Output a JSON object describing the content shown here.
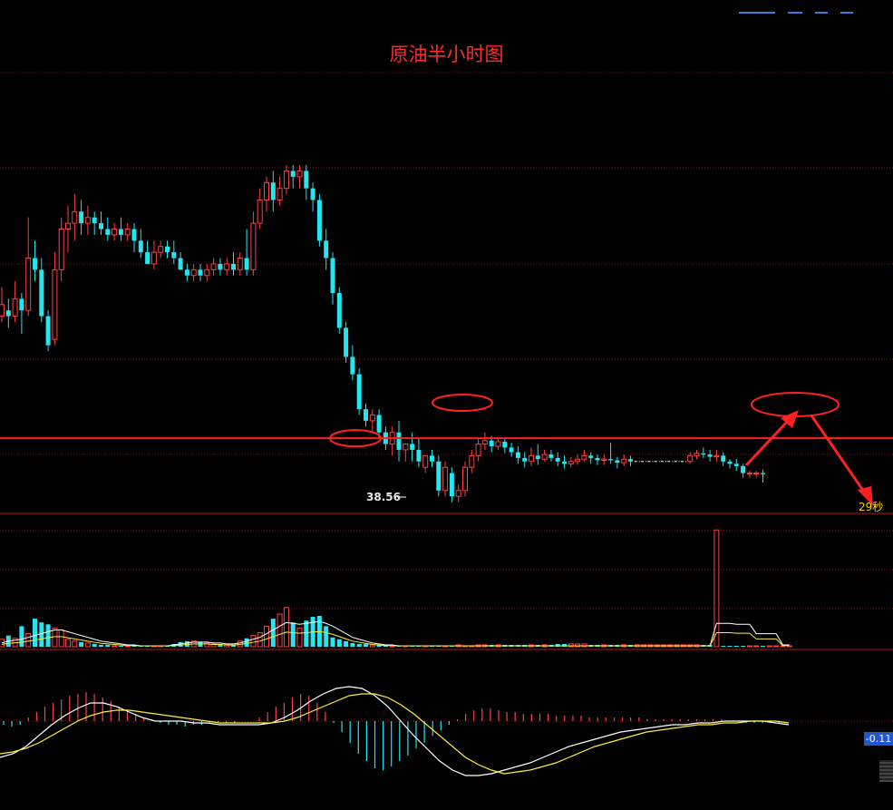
{
  "title": "原油半小时图",
  "low_label": "38.56",
  "timer_label": "29秒",
  "macd_label": "-0.11",
  "colors": {
    "up": "#ff4040",
    "down": "#22e6f0",
    "grid": "#8a1515",
    "resistance": "#ff2020",
    "ma_white": "#ffffff",
    "ma_yellow": "#ffee33"
  },
  "chart_data": [
    {
      "type": "candlestick",
      "title": "原油半小时图",
      "ylim": [
        38.4,
        41.6
      ],
      "candles": [
        [
          40.05,
          40.15,
          40.0,
          40.3
        ],
        [
          40.1,
          40.05,
          39.95,
          40.2
        ],
        [
          40.05,
          40.2,
          40.0,
          40.35
        ],
        [
          40.2,
          40.1,
          39.9,
          40.25
        ],
        [
          40.1,
          40.55,
          40.05,
          40.9
        ],
        [
          40.55,
          40.45,
          40.35,
          40.7
        ],
        [
          40.45,
          40.05,
          40.0,
          40.55
        ],
        [
          40.05,
          39.8,
          39.75,
          40.1
        ],
        [
          39.85,
          40.45,
          39.8,
          40.6
        ],
        [
          40.45,
          40.8,
          40.35,
          40.9
        ],
        [
          40.8,
          40.85,
          40.6,
          41.0
        ],
        [
          40.85,
          40.95,
          40.7,
          41.1
        ],
        [
          40.95,
          40.85,
          40.75,
          41.05
        ],
        [
          40.85,
          40.9,
          40.75,
          41.0
        ],
        [
          40.9,
          40.85,
          40.75,
          40.95
        ],
        [
          40.85,
          40.8,
          40.75,
          40.95
        ],
        [
          40.8,
          40.75,
          40.7,
          40.9
        ],
        [
          40.75,
          40.8,
          40.7,
          40.85
        ],
        [
          40.8,
          40.75,
          40.7,
          40.9
        ],
        [
          40.75,
          40.8,
          40.7,
          40.85
        ],
        [
          40.8,
          40.7,
          40.6,
          40.85
        ],
        [
          40.7,
          40.6,
          40.55,
          40.8
        ],
        [
          40.6,
          40.5,
          40.5,
          40.7
        ],
        [
          40.5,
          40.6,
          40.45,
          40.7
        ],
        [
          40.6,
          40.65,
          40.55,
          40.7
        ],
        [
          40.65,
          40.6,
          40.55,
          40.7
        ],
        [
          40.6,
          40.55,
          40.5,
          40.7
        ],
        [
          40.55,
          40.45,
          40.45,
          40.6
        ],
        [
          40.45,
          40.4,
          40.35,
          40.5
        ],
        [
          40.4,
          40.45,
          40.35,
          40.5
        ],
        [
          40.45,
          40.4,
          40.35,
          40.5
        ],
        [
          40.4,
          40.45,
          40.35,
          40.5
        ],
        [
          40.45,
          40.5,
          40.4,
          40.55
        ],
        [
          40.5,
          40.45,
          40.4,
          40.55
        ],
        [
          40.45,
          40.5,
          40.4,
          40.55
        ],
        [
          40.5,
          40.45,
          40.4,
          40.6
        ],
        [
          40.45,
          40.55,
          40.4,
          40.6
        ],
        [
          40.55,
          40.45,
          40.4,
          40.8
        ],
        [
          40.45,
          40.85,
          40.4,
          40.95
        ],
        [
          40.85,
          41.05,
          40.8,
          41.15
        ],
        [
          41.05,
          41.2,
          40.95,
          41.25
        ],
        [
          41.2,
          41.05,
          40.95,
          41.3
        ],
        [
          41.05,
          41.15,
          41.0,
          41.25
        ],
        [
          41.15,
          41.3,
          41.1,
          41.35
        ],
        [
          41.3,
          41.25,
          41.15,
          41.35
        ],
        [
          41.25,
          41.3,
          41.15,
          41.35
        ],
        [
          41.3,
          41.15,
          41.05,
          41.35
        ],
        [
          41.15,
          41.05,
          40.95,
          41.2
        ],
        [
          41.05,
          40.7,
          40.65,
          41.1
        ],
        [
          40.7,
          40.55,
          40.45,
          40.8
        ],
        [
          40.55,
          40.25,
          40.15,
          40.6
        ],
        [
          40.25,
          39.95,
          39.9,
          40.3
        ],
        [
          39.95,
          39.7,
          39.65,
          40.0
        ],
        [
          39.7,
          39.55,
          39.5,
          39.8
        ],
        [
          39.55,
          39.25,
          39.2,
          39.6
        ],
        [
          39.25,
          39.15,
          39.1,
          39.3
        ],
        [
          39.15,
          39.2,
          39.05,
          39.25
        ],
        [
          39.2,
          39.05,
          39.0,
          39.25
        ],
        [
          39.05,
          38.95,
          38.9,
          39.1
        ],
        [
          38.95,
          39.05,
          38.85,
          39.1
        ],
        [
          39.05,
          38.9,
          38.8,
          39.15
        ],
        [
          38.9,
          38.95,
          38.8,
          38.95
        ],
        [
          38.95,
          38.9,
          38.8,
          39.05
        ],
        [
          38.9,
          38.8,
          38.75,
          39.0
        ],
        [
          38.75,
          38.85,
          38.7,
          38.85
        ],
        [
          38.85,
          38.8,
          38.75,
          38.9
        ],
        [
          38.8,
          38.55,
          38.5,
          38.85
        ],
        [
          38.55,
          38.75,
          38.5,
          38.8
        ],
        [
          38.7,
          38.5,
          38.45,
          38.75
        ],
        [
          38.5,
          38.55,
          38.45,
          38.6
        ],
        [
          38.55,
          38.75,
          38.5,
          38.8
        ],
        [
          38.75,
          38.85,
          38.7,
          38.9
        ],
        [
          38.85,
          38.95,
          38.8,
          39.0
        ],
        [
          38.95,
          38.98,
          38.9,
          39.05
        ],
        [
          38.98,
          38.93,
          38.88,
          39.02
        ],
        [
          38.93,
          38.97,
          38.9,
          39.0
        ],
        [
          38.97,
          38.92,
          38.87,
          39.0
        ],
        [
          38.92,
          38.88,
          38.84,
          38.96
        ],
        [
          38.88,
          38.83,
          38.78,
          38.93
        ],
        [
          38.83,
          38.8,
          38.75,
          38.88
        ],
        [
          38.8,
          38.85,
          38.76,
          38.92
        ],
        [
          38.85,
          38.82,
          38.77,
          38.95
        ],
        [
          38.82,
          38.86,
          38.8,
          38.9
        ],
        [
          38.86,
          38.83,
          38.8,
          38.9
        ],
        [
          38.83,
          38.8,
          38.76,
          38.88
        ],
        [
          38.8,
          38.78,
          38.74,
          38.85
        ],
        [
          38.78,
          38.8,
          38.75,
          38.84
        ],
        [
          38.8,
          38.82,
          38.77,
          38.86
        ],
        [
          38.82,
          38.85,
          38.8,
          38.9
        ],
        [
          38.85,
          38.83,
          38.78,
          38.88
        ],
        [
          38.83,
          38.81,
          38.77,
          38.86
        ],
        [
          38.81,
          38.82,
          38.77,
          38.86
        ],
        [
          38.82,
          38.81,
          38.78,
          38.96
        ],
        [
          38.81,
          38.79,
          38.74,
          38.84
        ],
        [
          38.79,
          38.82,
          38.76,
          38.86
        ],
        [
          38.82,
          38.8,
          38.76,
          38.85
        ],
        [
          38.8,
          38.8,
          38.8,
          38.8
        ],
        [
          38.8,
          38.8,
          38.8,
          38.8
        ],
        [
          38.8,
          38.8,
          38.8,
          38.8
        ],
        [
          38.8,
          38.8,
          38.8,
          38.8
        ],
        [
          38.8,
          38.8,
          38.8,
          38.8
        ],
        [
          38.8,
          38.8,
          38.8,
          38.8
        ],
        [
          38.8,
          38.8,
          38.8,
          38.8
        ],
        [
          38.8,
          38.8,
          38.8,
          38.8
        ],
        [
          38.8,
          38.85,
          38.78,
          38.88
        ],
        [
          38.85,
          38.87,
          38.82,
          38.9
        ],
        [
          38.87,
          38.86,
          38.83,
          38.92
        ],
        [
          38.86,
          38.84,
          38.8,
          38.9
        ],
        [
          38.84,
          38.85,
          38.8,
          38.9
        ],
        [
          38.85,
          38.8,
          38.76,
          38.88
        ],
        [
          38.8,
          38.78,
          38.74,
          38.82
        ],
        [
          38.78,
          38.76,
          38.72,
          38.82
        ],
        [
          38.76,
          38.7,
          38.66,
          38.78
        ],
        [
          38.7,
          38.7,
          38.66,
          38.72
        ],
        [
          38.7,
          38.7,
          38.66,
          38.72
        ],
        [
          38.7,
          38.69,
          38.62,
          38.73
        ]
      ],
      "resistance_level": 39.0,
      "low_marker_value": 38.56
    },
    {
      "type": "bar",
      "series": [
        {
          "values": [
            8,
            12,
            9,
            22,
            14,
            30,
            26,
            24,
            20,
            18,
            8,
            6,
            5,
            4,
            3,
            2,
            2,
            1,
            1,
            1,
            1,
            1,
            1,
            1,
            1,
            1,
            3,
            5,
            6,
            6,
            5,
            4,
            3,
            3,
            2,
            2,
            6,
            9,
            12,
            15,
            22,
            30,
            35,
            42,
            26,
            20,
            28,
            32,
            33,
            22,
            10,
            8,
            6,
            4,
            3,
            3,
            2,
            2,
            2,
            1,
            1,
            1,
            1,
            1,
            1,
            1,
            1,
            1,
            1,
            2,
            1,
            1,
            2,
            2,
            2,
            2,
            2,
            2,
            2,
            2,
            2,
            2,
            2,
            2,
            3,
            3,
            3,
            3,
            3,
            2,
            2,
            2,
            2,
            2,
            2,
            2,
            2,
            2,
            2,
            2,
            2,
            2,
            2,
            2,
            2,
            2,
            2,
            2,
            125,
            1,
            1,
            1,
            1,
            1,
            1,
            1,
            1,
            1,
            1,
            1
          ]
        },
        {
          "values": [
            4,
            6,
            7,
            8,
            10,
            12,
            14,
            16,
            18,
            18,
            16,
            14,
            12,
            10,
            8,
            6,
            5,
            4,
            3,
            2,
            2,
            1,
            1,
            1,
            1,
            1,
            2,
            3,
            4,
            5,
            5,
            5,
            4,
            4,
            3,
            3,
            4,
            6,
            8,
            10,
            14,
            18,
            22,
            26,
            25,
            24,
            25,
            26,
            27,
            25,
            22,
            18,
            14,
            10,
            8,
            6,
            4,
            3,
            2,
            2,
            1,
            1,
            1,
            1,
            1,
            1,
            1,
            1,
            1,
            1,
            1,
            1,
            1,
            1,
            1,
            1,
            1,
            1,
            1,
            1,
            1,
            1,
            1,
            1,
            1,
            1,
            1,
            1,
            1,
            1,
            1,
            1,
            1,
            1,
            1,
            1,
            1,
            1,
            1,
            1,
            1,
            1,
            1,
            1,
            1,
            1,
            1,
            1,
            25,
            25,
            25,
            24,
            24,
            24,
            14,
            14,
            14,
            14,
            2,
            2
          ]
        }
      ]
    },
    {
      "type": "bar",
      "series": [
        {
          "values": [
            -0.02,
            -0.03,
            -0.02,
            0.02,
            0.05,
            0.08,
            0.1,
            0.12,
            0.14,
            0.15,
            0.16,
            0.15,
            0.13,
            0.11,
            0.08,
            0.06,
            0.04,
            0.02,
            0.01,
            -0.01,
            -0.02,
            -0.02,
            -0.03,
            -0.02,
            -0.02,
            -0.01,
            -0.01,
            -0.01,
            -0.01,
            0.0,
            0.0,
            0.02,
            0.05,
            0.08,
            0.1,
            0.13,
            0.15,
            0.14,
            0.1,
            0.05,
            -0.01,
            -0.06,
            -0.12,
            -0.18,
            -0.22,
            -0.26,
            -0.27,
            -0.25,
            -0.22,
            -0.19,
            -0.15,
            -0.12,
            -0.08,
            -0.05,
            -0.02,
            0.01,
            0.04,
            0.06,
            0.07,
            0.07,
            0.06,
            0.05,
            0.05,
            0.04,
            0.04,
            0.04,
            0.04,
            0.03,
            0.03,
            0.03,
            0.03,
            0.02,
            0.02,
            0.02,
            0.02,
            0.02,
            0.02,
            0.02,
            0.01,
            0.01,
            0.01,
            0.01,
            0.01,
            0.01,
            0.01,
            0.01,
            0.01,
            0.01,
            0.0,
            0.0,
            -0.01,
            -0.01,
            -0.01,
            -0.01,
            -0.01
          ]
        },
        {
          "values": [
            -0.2,
            -0.18,
            -0.14,
            -0.08,
            -0.02,
            0.03,
            0.07,
            0.1,
            0.1,
            0.08,
            0.05,
            0.02,
            0.0,
            0.0,
            0.0,
            -0.01,
            -0.01,
            -0.02,
            -0.02,
            -0.02,
            -0.02,
            -0.01,
            0.02,
            0.06,
            0.11,
            0.15,
            0.18,
            0.19,
            0.18,
            0.14,
            0.08,
            0.0,
            -0.08,
            -0.15,
            -0.22,
            -0.27,
            -0.3,
            -0.3,
            -0.29,
            -0.27,
            -0.25,
            -0.23,
            -0.2,
            -0.17,
            -0.14,
            -0.12,
            -0.1,
            -0.08,
            -0.06,
            -0.05,
            -0.04,
            -0.03,
            -0.02,
            -0.02,
            -0.01,
            -0.01,
            0.0,
            0.0,
            0.0,
            0.0,
            -0.01,
            -0.02
          ]
        },
        {
          "values": [
            -0.18,
            -0.17,
            -0.15,
            -0.12,
            -0.08,
            -0.04,
            0.0,
            0.03,
            0.05,
            0.06,
            0.06,
            0.05,
            0.04,
            0.03,
            0.02,
            0.01,
            0.0,
            -0.01,
            -0.01,
            -0.01,
            -0.01,
            -0.01,
            0.0,
            0.02,
            0.05,
            0.08,
            0.11,
            0.14,
            0.15,
            0.15,
            0.13,
            0.09,
            0.04,
            -0.02,
            -0.08,
            -0.14,
            -0.2,
            -0.24,
            -0.27,
            -0.29,
            -0.28,
            -0.27,
            -0.25,
            -0.23,
            -0.2,
            -0.17,
            -0.14,
            -0.12,
            -0.1,
            -0.08,
            -0.06,
            -0.05,
            -0.04,
            -0.03,
            -0.02,
            -0.02,
            -0.01,
            -0.01,
            0.0,
            0.0,
            0.0,
            -0.01
          ]
        }
      ]
    }
  ]
}
